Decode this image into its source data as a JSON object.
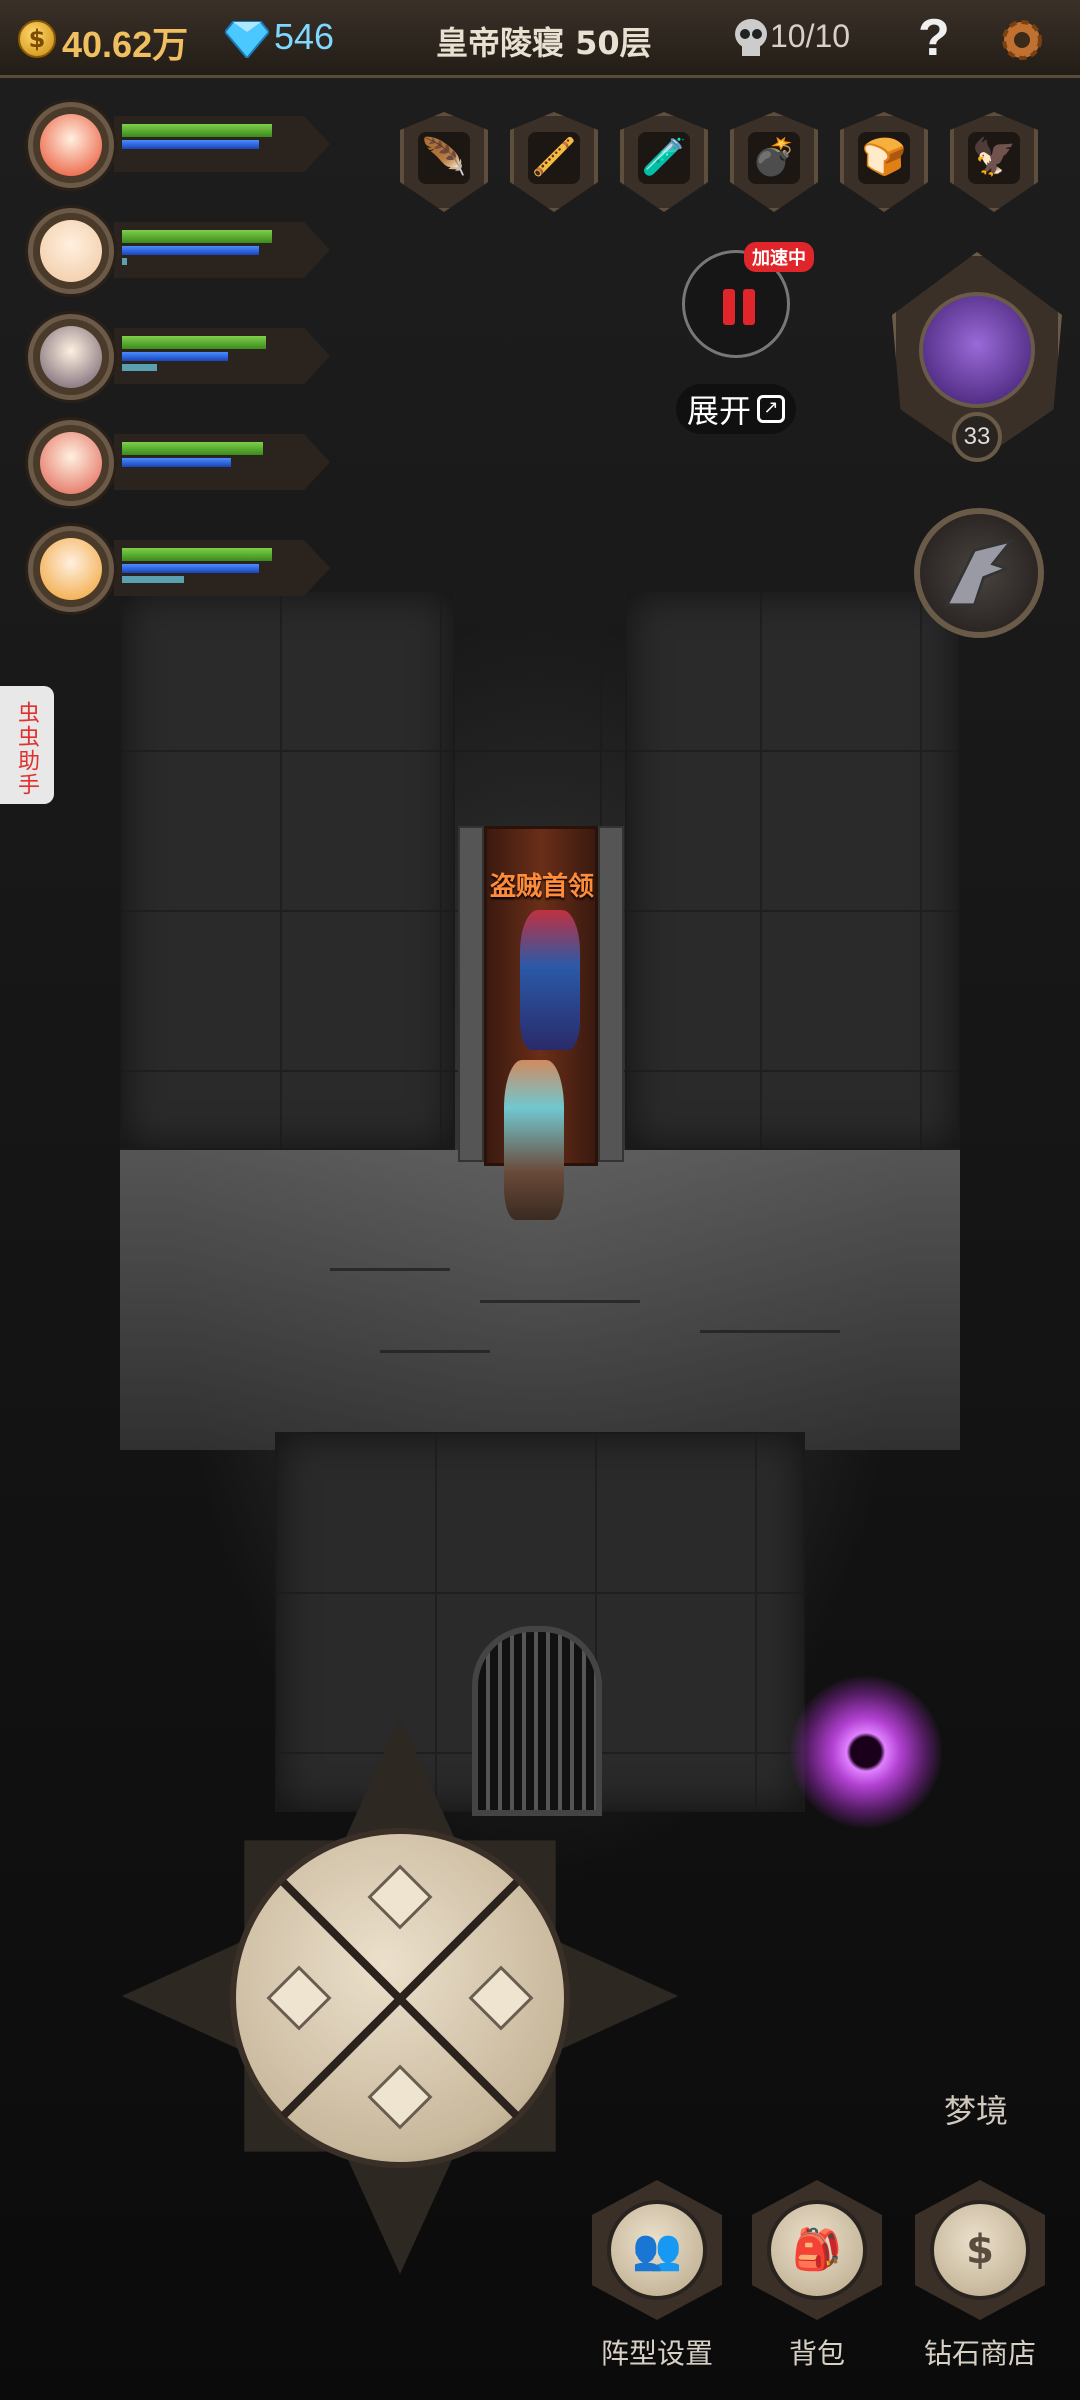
{
  "topbar": {
    "gold": "40.62万",
    "gems": "546",
    "stage": "皇帝陵寝 50层",
    "kills": "10/10",
    "help": "?"
  },
  "heroes": [
    {
      "name": "hero-1",
      "hp": 0.85,
      "mp": 0.78,
      "xp": 0.0,
      "color": "#e84a2a"
    },
    {
      "name": "hero-2",
      "hp": 0.85,
      "mp": 0.78,
      "xp": 0.03,
      "color": "#f0c8a0"
    },
    {
      "name": "hero-3",
      "hp": 0.82,
      "mp": 0.6,
      "xp": 0.2,
      "color": "#6a5a6a"
    },
    {
      "name": "hero-4",
      "hp": 0.8,
      "mp": 0.62,
      "xp": 0.0,
      "color": "#e06050"
    },
    {
      "name": "hero-5",
      "hp": 0.85,
      "mp": 0.78,
      "xp": 0.35,
      "color": "#f0a030"
    }
  ],
  "items": [
    {
      "icon": "feather-icon",
      "glyph": "🪶"
    },
    {
      "icon": "flute-icon",
      "glyph": "🪈"
    },
    {
      "icon": "potion-icon",
      "glyph": "🧪"
    },
    {
      "icon": "bomb-icon",
      "glyph": "💣"
    },
    {
      "icon": "bread-icon",
      "glyph": "🍞"
    },
    {
      "icon": "eagle-icon",
      "glyph": "🦅"
    }
  ],
  "controls": {
    "speed_badge": "加速中",
    "expand_label": "展开"
  },
  "boss": {
    "level": "33"
  },
  "helper": {
    "label": "虫虫助手"
  },
  "enemy": {
    "title": "盗贼首领"
  },
  "footer": {
    "dream": "梦境",
    "formation": "阵型设置",
    "bag": "背包",
    "shop": "钻石商店"
  }
}
